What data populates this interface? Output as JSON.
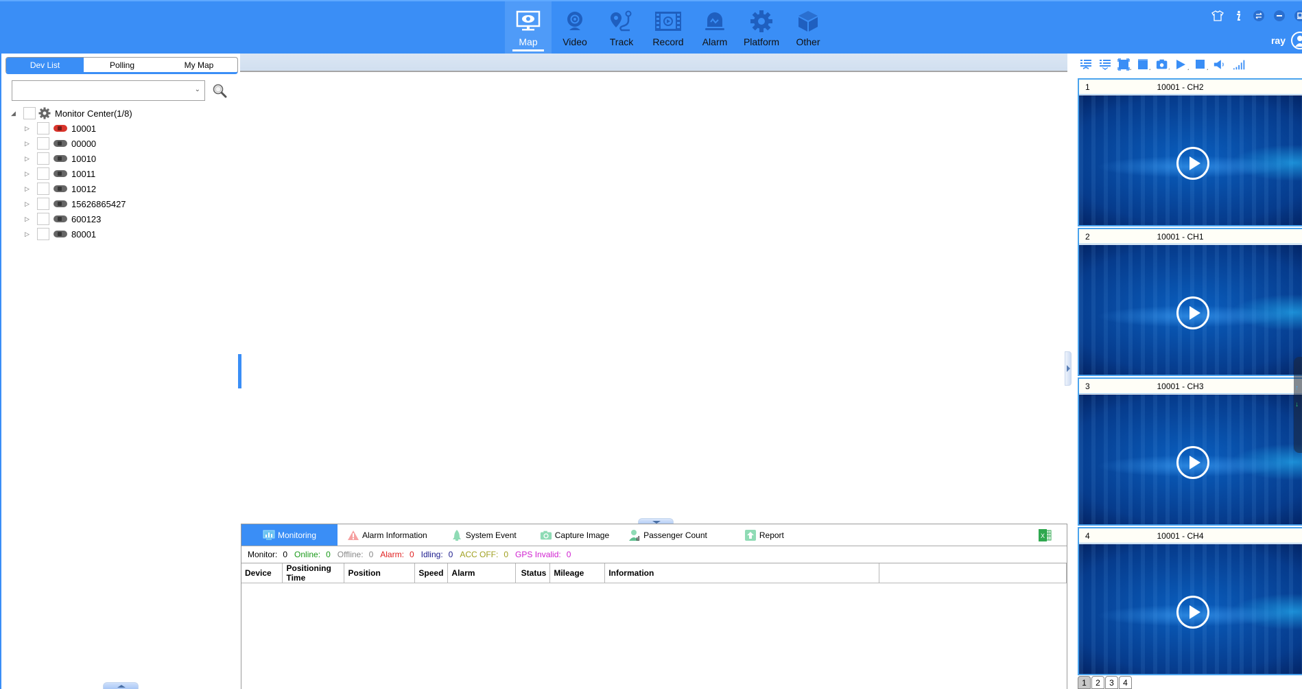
{
  "header": {
    "nav": [
      {
        "label": "Map",
        "icon": "monitor-eye-icon",
        "active": true
      },
      {
        "label": "Video",
        "icon": "webcam-icon",
        "active": false
      },
      {
        "label": "Track",
        "icon": "route-pin-icon",
        "active": false
      },
      {
        "label": "Record",
        "icon": "film-replay-icon",
        "active": false
      },
      {
        "label": "Alarm",
        "icon": "siren-icon",
        "active": false
      },
      {
        "label": "Platform",
        "icon": "gear-icon",
        "active": false
      },
      {
        "label": "Other",
        "icon": "cube-icon",
        "active": false
      }
    ],
    "system_icons": [
      "skin-shirt-icon",
      "info-icon",
      "switch-icon",
      "minimize-icon",
      "restore-icon"
    ],
    "user": {
      "name": "ray",
      "icon": "user-avatar-icon"
    }
  },
  "sidebar": {
    "tabs": [
      {
        "label": "Dev List",
        "active": true
      },
      {
        "label": "Polling",
        "active": false
      },
      {
        "label": "My Map",
        "active": false
      }
    ],
    "search": {
      "value": "",
      "placeholder": ""
    },
    "tree": {
      "root": {
        "label": "Monitor Center(1/8)",
        "expanded": true
      },
      "devices": [
        {
          "label": "10001",
          "status": "online-alarm",
          "color": "#d9342b"
        },
        {
          "label": "00000",
          "status": "offline",
          "color": "#666666"
        },
        {
          "label": "10010",
          "status": "offline",
          "color": "#666666"
        },
        {
          "label": "10011",
          "status": "offline",
          "color": "#666666"
        },
        {
          "label": "10012",
          "status": "offline",
          "color": "#666666"
        },
        {
          "label": "15626865427",
          "status": "offline",
          "color": "#666666"
        },
        {
          "label": "600123",
          "status": "offline",
          "color": "#666666"
        },
        {
          "label": "80001",
          "status": "offline",
          "color": "#666666"
        }
      ]
    }
  },
  "bottom_panel": {
    "tabs": [
      {
        "label": "Monitoring",
        "icon": "monitor-chart-icon",
        "active": true
      },
      {
        "label": "Alarm Information",
        "icon": "warning-icon",
        "active": false
      },
      {
        "label": "System Event",
        "icon": "bell-icon",
        "active": false
      },
      {
        "label": "Capture Image",
        "icon": "camera-icon",
        "active": false
      },
      {
        "label": "Passenger Count",
        "icon": "person-chart-icon",
        "active": false
      },
      {
        "label": "Report",
        "icon": "upload-report-icon",
        "active": false
      }
    ],
    "export_icon": "excel-icon",
    "status": [
      {
        "key": "Monitor:",
        "value": "0",
        "color": "#000000"
      },
      {
        "key": "Online:",
        "value": "0",
        "color": "#1a9a1a"
      },
      {
        "key": "Offline:",
        "value": "0",
        "color": "#888888"
      },
      {
        "key": "Alarm:",
        "value": "0",
        "color": "#e02020"
      },
      {
        "key": "Idling:",
        "value": "0",
        "color": "#1a1a8c"
      },
      {
        "key": "ACC OFF:",
        "value": "0",
        "color": "#a0a020"
      },
      {
        "key": "GPS Invalid:",
        "value": "0",
        "color": "#d020d0"
      }
    ],
    "columns": [
      "Device",
      "Positioning Time",
      "Position",
      "Speed",
      "Alarm",
      "Status",
      "Mileage",
      "Information",
      ""
    ],
    "rows": []
  },
  "video_panel": {
    "toolbar": [
      "list-expand-icon",
      "list-collapse-icon",
      "fullscreen-icon",
      "layout-icon",
      "snapshot-icon",
      "play-all-icon",
      "stop-all-icon",
      "volume-icon",
      "signal-icon"
    ],
    "tiles": [
      {
        "index": "1",
        "title": "10001 - CH2"
      },
      {
        "index": "2",
        "title": "10001 - CH1"
      },
      {
        "index": "3",
        "title": "10001 - CH3"
      },
      {
        "index": "4",
        "title": "10001 - CH4"
      }
    ],
    "pages": [
      {
        "label": "1",
        "active": true
      },
      {
        "label": "2",
        "active": false
      },
      {
        "label": "3",
        "active": false
      },
      {
        "label": "4",
        "active": false
      }
    ]
  },
  "colors": {
    "accent": "#3a8ef6",
    "nav_icon": "#1f5fbf",
    "tile_border": "#4aa3ee"
  }
}
